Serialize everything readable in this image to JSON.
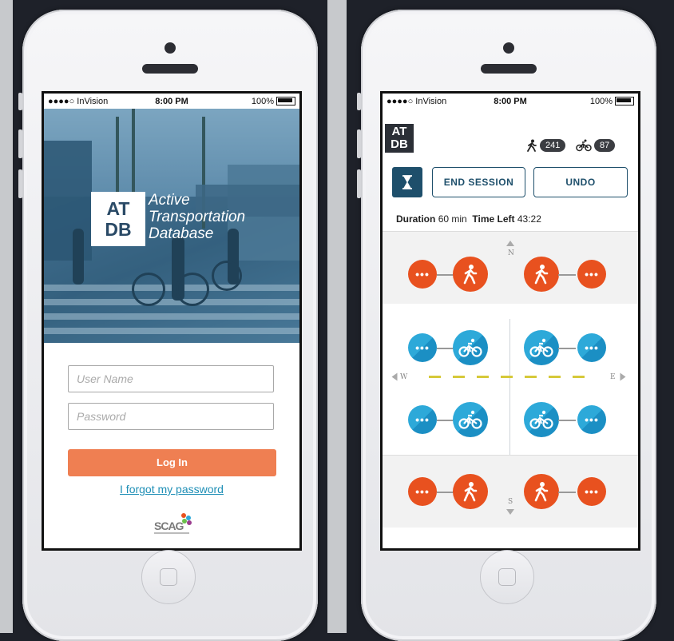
{
  "login_screen": {
    "status_bar": {
      "carrier": "●●●●○ InVision",
      "time": "8:00 PM",
      "battery": "100%"
    },
    "logo": {
      "line1": "AT",
      "line2": "DB"
    },
    "title_lines": [
      "Active",
      "Transportation",
      "Database"
    ],
    "username_placeholder": "User Name",
    "password_placeholder": "Password",
    "login_label": "Log In",
    "forgot_link": "I forgot my password",
    "footer_logo": "SCAG"
  },
  "session_screen": {
    "status_bar": {
      "carrier": "●●●●○ InVision",
      "time": "8:00 PM",
      "battery": "100%"
    },
    "logo": {
      "line1": "AT",
      "line2": "DB"
    },
    "pedestrian_count": "241",
    "bike_count": "87",
    "end_session_label": "END SESSION",
    "undo_label": "UNDO",
    "duration_label": "Duration",
    "duration_value": "60 min",
    "time_left_label": "Time Left",
    "time_left_value": "43:22",
    "more_glyph": "•••",
    "compass": {
      "n": "N",
      "s": "S",
      "e": "E",
      "w": "W"
    },
    "colors": {
      "pedestrian": "#e8511f",
      "bike": "#2da9d9",
      "primary": "#1e4f6b",
      "login": "#ef7f52"
    }
  }
}
